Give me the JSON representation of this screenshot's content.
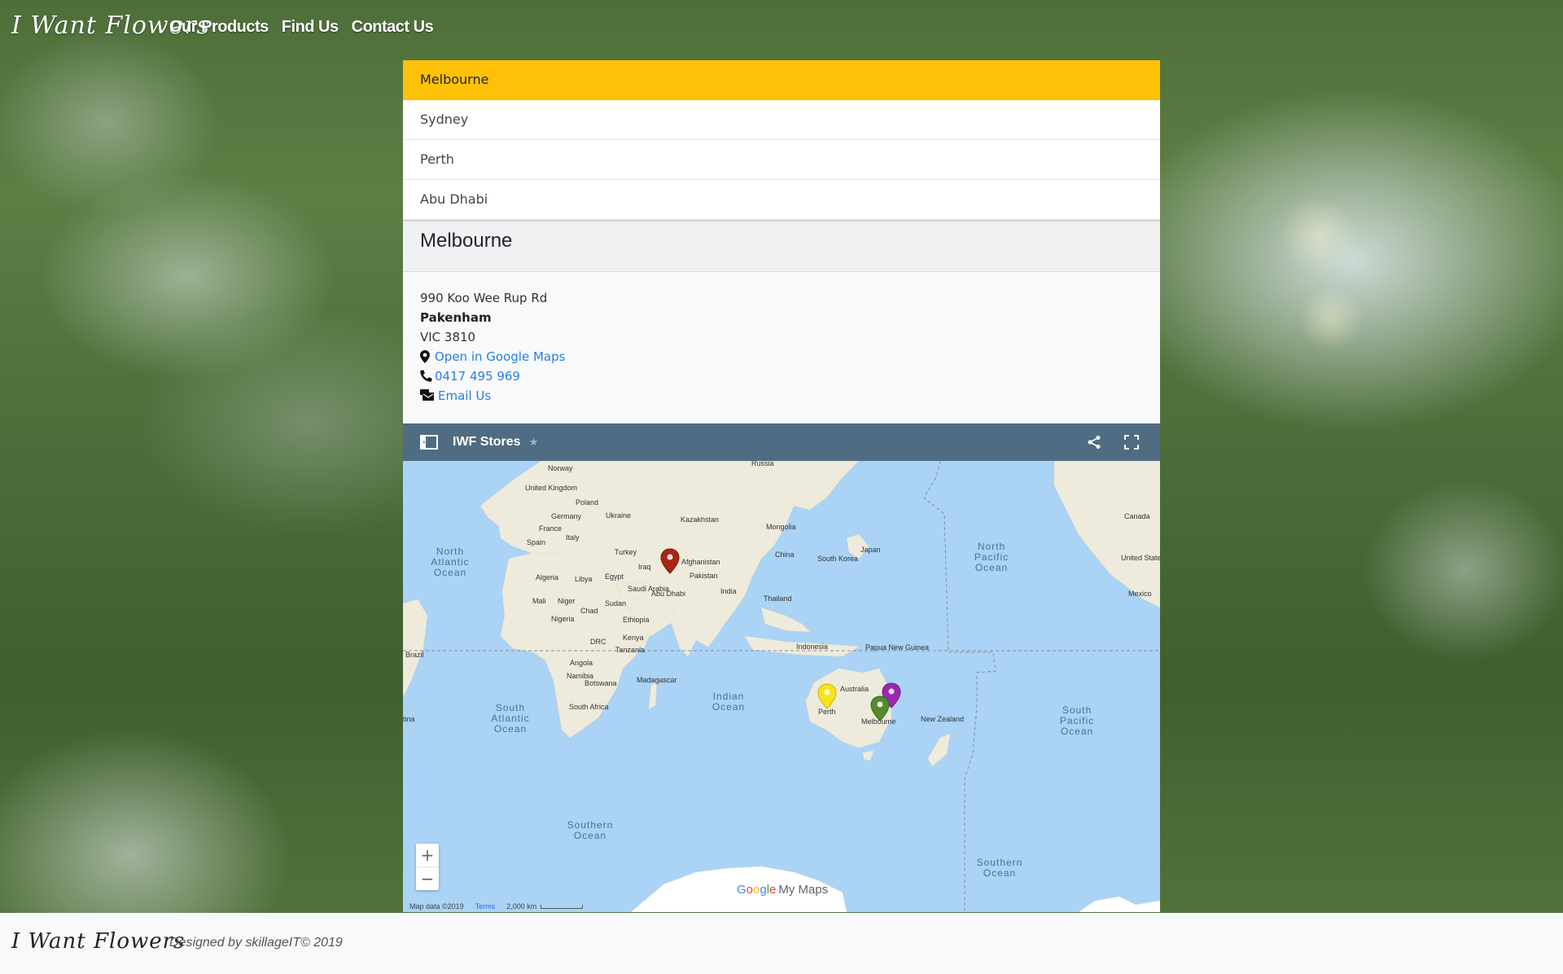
{
  "navbar": {
    "brand": "I Want Flowers",
    "links": [
      "Our Products",
      "Find Us",
      "Contact Us"
    ]
  },
  "locations": [
    "Melbourne",
    "Sydney",
    "Perth",
    "Abu Dhabi"
  ],
  "selected_location": "Melbourne",
  "store": {
    "title": "Melbourne",
    "street": "990 Koo Wee Rup Rd",
    "suburb": "Pakenham",
    "state_postcode": "VIC 3810",
    "maps_link": "Open in Google Maps",
    "phone": "0417 495 969",
    "email_link": "Email Us"
  },
  "map": {
    "title": "IWF Stores",
    "star": "★",
    "zoom_in": "+",
    "zoom_out": "−",
    "logo_google": "Google",
    "logo_mymaps": "My Maps",
    "attribution": "Map data ©2019",
    "terms": "Terms",
    "scale": "2,000 km",
    "labels": {
      "norway": "Norway",
      "russia": "Russia",
      "uk": "United Kingdom",
      "poland": "Poland",
      "germany": "Germany",
      "ukraine": "Ukraine",
      "france": "France",
      "kazakhstan": "Kazakhstan",
      "mongolia": "Mongolia",
      "spain": "Spain",
      "italy": "Italy",
      "turkey": "Turkey",
      "china": "China",
      "japan": "Japan",
      "south_korea": "South Korea",
      "iraq": "Iraq",
      "afghanistan": "Afghanistan",
      "algeria": "Algeria",
      "libya": "Libya",
      "egypt": "Egypt",
      "pakistan": "Pakistan",
      "saudi": "Saudi Arabia",
      "abu_dhabi": "Abu Dhabi",
      "india": "India",
      "thailand": "Thailand",
      "mali": "Mali",
      "niger": "Niger",
      "sudan": "Sudan",
      "chad": "Chad",
      "nigeria": "Nigeria",
      "ethiopia": "Ethiopia",
      "kenya": "Kenya",
      "drc": "DRC",
      "tanzania": "Tanzania",
      "indonesia": "Indonesia",
      "png": "Papua New Guinea",
      "angola": "Angola",
      "namibia": "Namibia",
      "botswana": "Botswana",
      "madagascar": "Madagascar",
      "australia": "Australia",
      "perth": "Perth",
      "melbourne": "Melbourne",
      "nz": "New Zealand",
      "south_africa": "South Africa",
      "brazil": "Brazil",
      "canada": "Canada",
      "united_states": "United States",
      "mexico": "Mexico",
      "argentina": "tina",
      "north_atlantic": "North Atlantic Ocean",
      "south_atlantic": "South Atlantic Ocean",
      "indian_ocean": "Indian Ocean",
      "north_pacific": "North Pacific Ocean",
      "south_pacific": "South Pacific Ocean",
      "southern_ocean": "Southern Ocean"
    },
    "marker_colors": {
      "abu_dhabi": "#a52714",
      "perth": "#f8e21b",
      "melbourne": "#558b2f",
      "sydney": "#9c27b0"
    }
  },
  "footer": {
    "brand": "I Want Flowers",
    "credit": "Designed by skillageIT© 2019"
  },
  "colors": {
    "active_item": "#ffc107",
    "link": "#2a7ee0",
    "map_header": "#4f6c82",
    "ocean": "#aad3f5",
    "land": "#f2efe1"
  }
}
